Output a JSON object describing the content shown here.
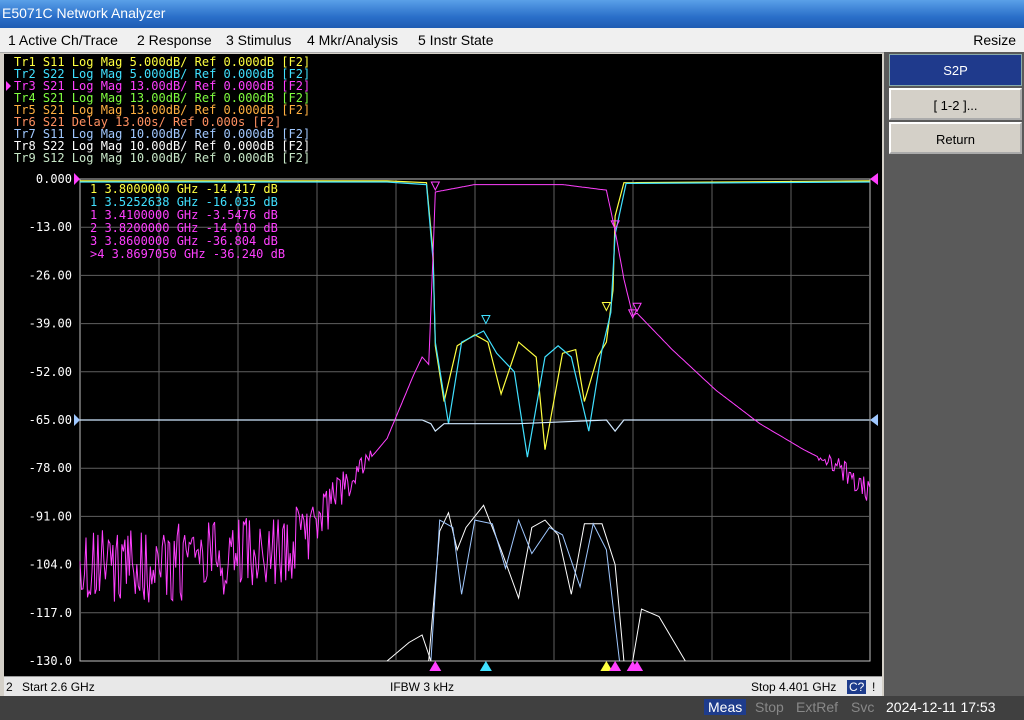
{
  "window": {
    "title": "E5071C Network Analyzer"
  },
  "menu": [
    {
      "label": "1 Active Ch/Trace"
    },
    {
      "label": "2 Response"
    },
    {
      "label": "3 Stimulus"
    },
    {
      "label": "4 Mkr/Analysis"
    },
    {
      "label": "5 Instr State"
    }
  ],
  "menu_right": "Resize",
  "traces": [
    {
      "label": "Tr1 S11 Log Mag 5.000dB/ Ref 0.000dB [F2]",
      "color": "#ffff40"
    },
    {
      "label": "Tr2 S22 Log Mag 5.000dB/ Ref 0.000dB [F2]",
      "color": "#40e0ff"
    },
    {
      "label": "Tr3 S21 Log Mag 13.00dB/ Ref 0.000dB [F2]",
      "color": "#ff40ff"
    },
    {
      "label": "Tr4 S21 Log Mag 13.00dB/ Ref 0.000dB [F2]",
      "color": "#80ff40"
    },
    {
      "label": "Tr5 S21 Log Mag 13.00dB/ Ref 0.000dB [F2]",
      "color": "#ffb040"
    },
    {
      "label": "Tr6 S21 Delay 13.00s/ Ref 0.000s [F2]",
      "color": "#ff9060"
    },
    {
      "label": "Tr7 S11 Log Mag 10.00dB/ Ref 0.000dB [F2]",
      "color": "#a0c8ff"
    },
    {
      "label": "Tr8 S22 Log Mag 10.00dB/ Ref 0.000dB [F2]",
      "color": "#ffffff"
    },
    {
      "label": "Tr9 S12 Log Mag 10.00dB/ Ref 0.000dB [F2]",
      "color": "#c8e8c8"
    }
  ],
  "markers": [
    {
      "label": "1   3.8000000 GHz -14.417 dB",
      "color": "#ffff40"
    },
    {
      "label": "1   3.5252638 GHz -16.035 dB",
      "color": "#40e0ff"
    },
    {
      "label": "1   3.4100000 GHz -3.5476 dB",
      "color": "#ff40ff"
    },
    {
      "label": "2   3.8200000 GHz -14.010 dB",
      "color": "#ff40ff"
    },
    {
      "label": "3   3.8600000 GHz -36.804 dB",
      "color": "#ff40ff"
    },
    {
      "label": ">4  3.8697050 GHz -36.240 dB",
      "color": "#ff40ff"
    }
  ],
  "chart_data": {
    "type": "line",
    "y_ticks": [
      "0.000",
      "-13.00",
      "-26.00",
      "-39.00",
      "-52.00",
      "-65.00",
      "-78.00",
      "-91.00",
      "-104.0",
      "-117.0",
      "-130.0"
    ],
    "ylim": [
      -130,
      0
    ],
    "xlim_ghz": [
      2.6,
      4.401
    ],
    "series_s21_main": {
      "name": "S21",
      "color": "#ff40ff",
      "x": [
        2.6,
        2.9,
        3.1,
        3.2,
        3.3,
        3.36,
        3.38,
        3.395,
        3.405,
        3.41,
        3.5,
        3.6,
        3.7,
        3.8,
        3.82,
        3.84,
        3.86,
        3.87,
        3.95,
        4.05,
        4.15,
        4.25,
        4.35,
        4.4
      ],
      "y": [
        -105,
        -103,
        -98,
        -84,
        -70,
        -53,
        -48,
        -50,
        -20,
        -3.5,
        -1.5,
        -1.5,
        -1.5,
        -3,
        -14,
        -27,
        -36.8,
        -36.2,
        -46,
        -57,
        -66,
        -73,
        -79,
        -83
      ]
    }
  },
  "softkeys": {
    "header": "S2P",
    "items": [
      {
        "label": "[ 1-2 ]..."
      },
      {
        "label": "Return"
      }
    ]
  },
  "status": {
    "start": "Start 2.6 GHz",
    "ifbw": "IFBW 3 kHz",
    "stop": "Stop 4.401 GHz",
    "badge": "C?",
    "left_num": "2",
    "excl": "!"
  },
  "bottom": {
    "meas": "Meas",
    "stop": "Stop",
    "extref": "ExtRef",
    "svc": "Svc",
    "datetime": "2024-12-11 17:53"
  }
}
